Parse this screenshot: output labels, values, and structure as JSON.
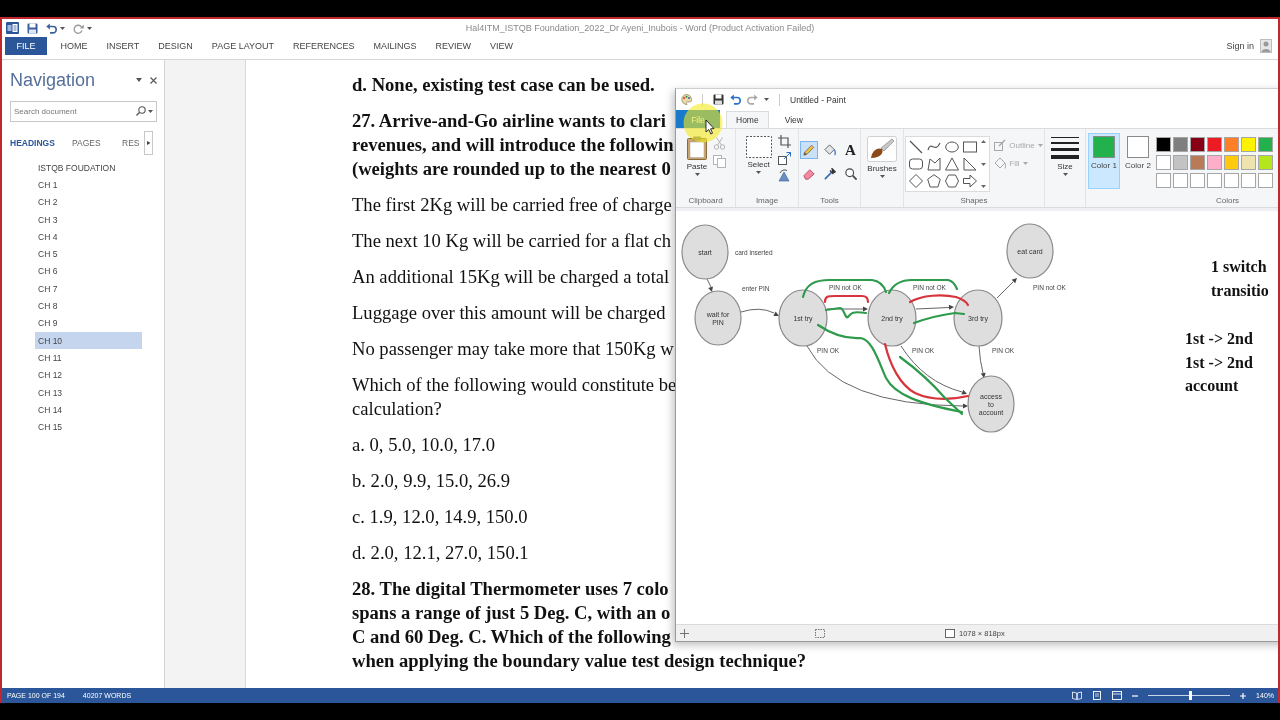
{
  "word": {
    "title": "Hal4ITM_ISTQB Foundation_2022_Dr Ayeni_Inubois - Word (Product Activation Failed)",
    "tabs": [
      {
        "label": "FILE",
        "kind": "backstage"
      },
      {
        "label": "HOME",
        "kind": "tab"
      },
      {
        "label": "INSERT",
        "kind": "tab"
      },
      {
        "label": "DESIGN",
        "kind": "tab"
      },
      {
        "label": "PAGE LAYOUT",
        "kind": "tab"
      },
      {
        "label": "REFERENCES",
        "kind": "tab"
      },
      {
        "label": "MAILINGS",
        "kind": "tab"
      },
      {
        "label": "REVIEW",
        "kind": "tab"
      },
      {
        "label": "VIEW",
        "kind": "tab"
      }
    ],
    "sign_in": "Sign in"
  },
  "navigation": {
    "title": "Navigation",
    "search": {
      "placeholder": "Search document"
    },
    "tabs": [
      {
        "label": "HEADINGS",
        "selected": true
      },
      {
        "label": "PAGES",
        "selected": false
      },
      {
        "label": "RES",
        "selected": false
      }
    ],
    "headings": [
      {
        "label": "ISTQB FOUDATION",
        "selected": false
      },
      {
        "label": "CH 1",
        "selected": false
      },
      {
        "label": "CH 2",
        "selected": false
      },
      {
        "label": "CH 3",
        "selected": false
      },
      {
        "label": "CH 4",
        "selected": false
      },
      {
        "label": "CH 5",
        "selected": false
      },
      {
        "label": "CH 6",
        "selected": false
      },
      {
        "label": "CH 7",
        "selected": false
      },
      {
        "label": "CH 8",
        "selected": false
      },
      {
        "label": "CH 9",
        "selected": false
      },
      {
        "label": "CH 10",
        "selected": true
      },
      {
        "label": "CH 11",
        "selected": false
      },
      {
        "label": "CH 12",
        "selected": false
      },
      {
        "label": "CH 13",
        "selected": false
      },
      {
        "label": "CH 14",
        "selected": false
      },
      {
        "label": "CH 15",
        "selected": false
      }
    ]
  },
  "document": {
    "paragraphs": [
      {
        "bold": true,
        "lines": [
          "d. None, existing test case can be used."
        ]
      },
      {
        "bold": true,
        "lines": [
          "27. Arrive-and-Go airline wants to clari",
          "revenues, and will introduce the followin",
          "(weights are rounded up to the nearest 0"
        ]
      },
      {
        "bold": false,
        "lines": [
          "The first 2Kg will be carried free of charge"
        ]
      },
      {
        "bold": false,
        "lines": [
          "The next 10 Kg will be carried for a flat ch"
        ]
      },
      {
        "bold": false,
        "lines": [
          "An additional 15Kg will be charged a total"
        ]
      },
      {
        "bold": false,
        "lines": [
          "Luggage over this amount will be charged"
        ]
      },
      {
        "bold": false,
        "lines": [
          "No passenger may take more that 150Kg w"
        ]
      },
      {
        "bold": false,
        "lines": [
          "Which of the following would constitute be",
          "calculation?"
        ]
      },
      {
        "bold": false,
        "lines": [
          "a. 0, 5.0, 10.0, 17.0"
        ]
      },
      {
        "bold": false,
        "lines": [
          "b. 2.0, 9.9, 15.0, 26.9"
        ]
      },
      {
        "bold": false,
        "lines": [
          "c. 1.9, 12.0, 14.9, 150.0"
        ]
      },
      {
        "bold": false,
        "lines": [
          "d. 2.0, 12.1, 27.0, 150.1"
        ]
      },
      {
        "bold": true,
        "lines": [
          "28. The digital Thermometer uses 7 colo",
          "spans a range of just 5 Deg. C, with an o",
          "C and 60 Deg. C. Which of the following",
          "when applying the boundary value test design technique?"
        ]
      }
    ]
  },
  "paint": {
    "title": "Untitled - Paint",
    "tabs": [
      {
        "label": "File",
        "kind": "file",
        "selected": false
      },
      {
        "label": "Home",
        "kind": "tab",
        "selected": true
      },
      {
        "label": "View",
        "kind": "tab",
        "selected": false
      }
    ],
    "clipboard": {
      "label": "Clipboard",
      "paste": "Paste",
      "cut": {
        "disabled": true
      },
      "copy": {
        "disabled": true
      }
    },
    "image": {
      "label": "Image",
      "select": "Select"
    },
    "tools": {
      "label": "Tools",
      "items": [
        {
          "kind": "pencil",
          "selected": true
        },
        {
          "kind": "fill",
          "selected": false
        },
        {
          "kind": "text",
          "glyph": "A",
          "selected": false
        },
        {
          "kind": "eraser",
          "selected": false
        },
        {
          "kind": "picker",
          "selected": false
        },
        {
          "kind": "magnifier",
          "selected": false
        }
      ]
    },
    "brushes": {
      "label": "Brushes"
    },
    "shapes": {
      "label": "Shapes",
      "outline": {
        "label": "Outline",
        "disabled": true
      },
      "fill": {
        "label": "Fill",
        "disabled": true
      }
    },
    "size": {
      "label": "Size"
    },
    "colors": {
      "label": "Colors",
      "color_1": {
        "label": "Color 1",
        "color": "#22b14c",
        "selected": true
      },
      "color_2": {
        "label": "Color 2",
        "color": "#ffffff",
        "selected": false
      },
      "palette": [
        {
          "color": "#000000"
        },
        {
          "color": "#7f7f7f"
        },
        {
          "color": "#880015"
        },
        {
          "color": "#ed1c24"
        },
        {
          "color": "#ff7f27"
        },
        {
          "color": "#fff200"
        },
        {
          "color": "#22b14c"
        },
        {
          "color": "#ffffff"
        },
        {
          "color": "#c3c3c3"
        },
        {
          "color": "#b97a57"
        },
        {
          "color": "#ffaec9"
        },
        {
          "color": "#ffc90e"
        },
        {
          "color": "#efe4b0"
        },
        {
          "color": "#b5e61d"
        },
        {
          "color": "#ffffff"
        },
        {
          "color": "#ffffff"
        },
        {
          "color": "#ffffff"
        },
        {
          "color": "#ffffff"
        },
        {
          "color": "#ffffff"
        },
        {
          "color": "#ffffff"
        },
        {
          "color": "#ffffff"
        }
      ]
    },
    "canvas": {
      "nodes": [
        {
          "lines": [
            "start"
          ]
        },
        {
          "lines": [
            "wait for",
            "PIN"
          ]
        },
        {
          "lines": [
            "1st try"
          ]
        },
        {
          "lines": [
            "2nd try"
          ]
        },
        {
          "lines": [
            "3rd try"
          ]
        },
        {
          "lines": [
            "eat card"
          ]
        },
        {
          "lines": [
            "access",
            "to",
            "account"
          ]
        }
      ],
      "edges": [
        {
          "label": "card inserted"
        },
        {
          "label": "enter PIN"
        },
        {
          "label": "PIN not OK"
        },
        {
          "label": "PIN not OK"
        },
        {
          "label": "PIN not OK"
        },
        {
          "label": "PIN OK"
        },
        {
          "label": "PIN OK"
        },
        {
          "label": "PIN OK"
        }
      ],
      "strokes": [
        {
          "color": "#2e9a4c"
        },
        {
          "color": "#d8343c"
        },
        {
          "color": "#2e9a4c"
        },
        {
          "color": "#d8343c"
        },
        {
          "color": "#2e9a4c"
        },
        {
          "color": "#2e9a4c"
        },
        {
          "color": "#2e9a4c"
        },
        {
          "color": "#d8343c"
        },
        {
          "color": "#2e9a4c"
        }
      ],
      "notes": [
        "1 switch",
        "transitio",
        "1st -> 2nd",
        "1st -> 2nd",
        "account"
      ]
    },
    "status": {
      "size": "1078 × 818px"
    }
  },
  "status_bar": {
    "page": "PAGE 100 OF 194",
    "words": "40207 WORDS",
    "zoom": "140%",
    "zoom_slider": {
      "level": 0.52
    }
  }
}
